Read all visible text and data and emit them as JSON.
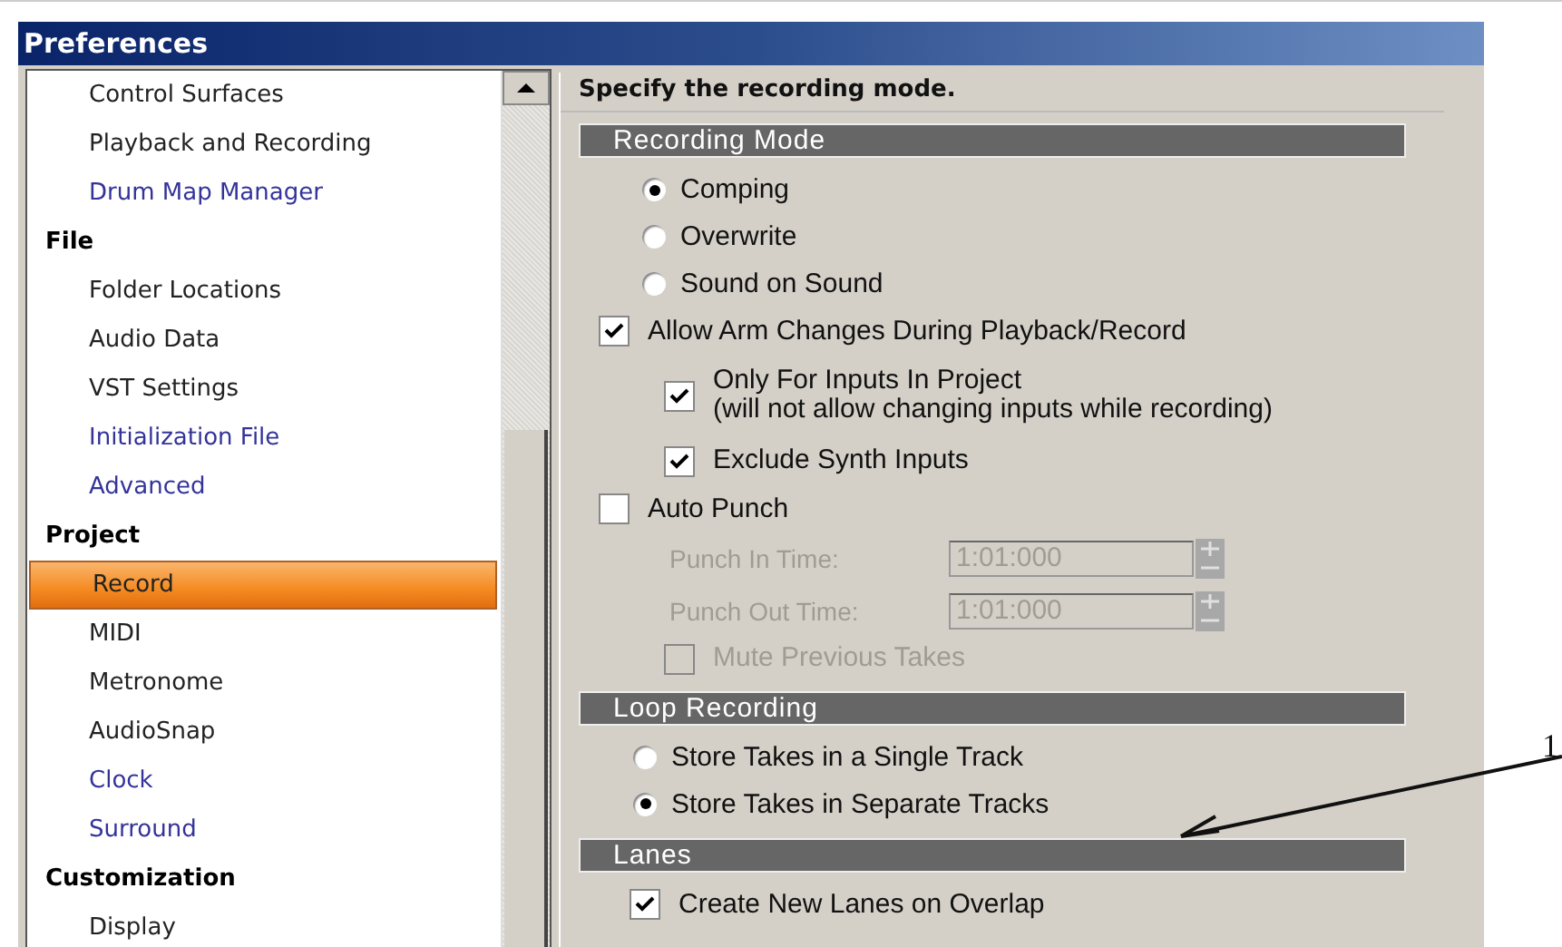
{
  "window": {
    "title": "Preferences"
  },
  "sidebar": {
    "items": [
      {
        "label": "Control Surfaces",
        "kind": "page",
        "selected": false,
        "color": "#222222"
      },
      {
        "label": "Playback and Recording",
        "kind": "page",
        "selected": false,
        "color": "#222222"
      },
      {
        "label": "Drum Map Manager",
        "kind": "page",
        "selected": false,
        "color": "#33339a"
      },
      {
        "label": "File",
        "kind": "category",
        "color": "#000000"
      },
      {
        "label": "Folder Locations",
        "kind": "page",
        "selected": false,
        "color": "#222222"
      },
      {
        "label": "Audio Data",
        "kind": "page",
        "selected": false,
        "color": "#222222"
      },
      {
        "label": "VST Settings",
        "kind": "page",
        "selected": false,
        "color": "#222222"
      },
      {
        "label": "Initialization File",
        "kind": "page",
        "selected": false,
        "color": "#33339a"
      },
      {
        "label": "Advanced",
        "kind": "page",
        "selected": false,
        "color": "#33339a"
      },
      {
        "label": "Project",
        "kind": "category",
        "color": "#000000"
      },
      {
        "label": "Record",
        "kind": "page",
        "selected": true,
        "color": "#222222"
      },
      {
        "label": "MIDI",
        "kind": "page",
        "selected": false,
        "color": "#222222"
      },
      {
        "label": "Metronome",
        "kind": "page",
        "selected": false,
        "color": "#222222"
      },
      {
        "label": "AudioSnap",
        "kind": "page",
        "selected": false,
        "color": "#222222"
      },
      {
        "label": "Clock",
        "kind": "page",
        "selected": false,
        "color": "#33339a"
      },
      {
        "label": "Surround",
        "kind": "page",
        "selected": false,
        "color": "#33339a"
      },
      {
        "label": "Customization",
        "kind": "category",
        "color": "#000000"
      },
      {
        "label": "Display",
        "kind": "page",
        "selected": false,
        "color": "#222222"
      }
    ]
  },
  "panel": {
    "description": "Specify the recording mode.",
    "sections": [
      {
        "title": "Recording Mode",
        "items": [
          {
            "kind": "radio",
            "label": "Comping",
            "selected": true
          },
          {
            "kind": "radio",
            "label": "Overwrite",
            "selected": false
          },
          {
            "kind": "radio",
            "label": "Sound on Sound",
            "selected": false
          },
          {
            "kind": "checkbox",
            "label": "Allow Arm Changes During Playback/Record",
            "checked": true,
            "disabled": false,
            "children": [
              {
                "kind": "checkbox",
                "label": "Only For Inputs In Project",
                "note": "(will not allow changing inputs while recording)",
                "checked": true,
                "disabled": false
              },
              {
                "kind": "checkbox",
                "label": "Exclude Synth Inputs",
                "checked": true,
                "disabled": false
              }
            ]
          },
          {
            "kind": "checkbox",
            "label": "Auto Punch",
            "checked": false,
            "disabled": false,
            "children": [
              {
                "kind": "time_field",
                "label": "Punch In Time:",
                "value": "1:01:000",
                "disabled": true
              },
              {
                "kind": "time_field",
                "label": "Punch Out Time:",
                "value": "1:01:000",
                "disabled": true
              },
              {
                "kind": "checkbox",
                "label": "Mute Previous Takes",
                "checked": false,
                "disabled": true
              }
            ]
          }
        ]
      },
      {
        "title": "Loop Recording",
        "items": [
          {
            "kind": "radio",
            "label": "Store Takes in a Single Track",
            "selected": false
          },
          {
            "kind": "radio",
            "label": "Store Takes in Separate Tracks",
            "selected": true
          }
        ]
      },
      {
        "title": "Lanes",
        "items": [
          {
            "kind": "checkbox",
            "label": "Create New Lanes on Overlap",
            "checked": true,
            "disabled": false
          }
        ]
      }
    ]
  },
  "annotation": {
    "label": "1"
  }
}
